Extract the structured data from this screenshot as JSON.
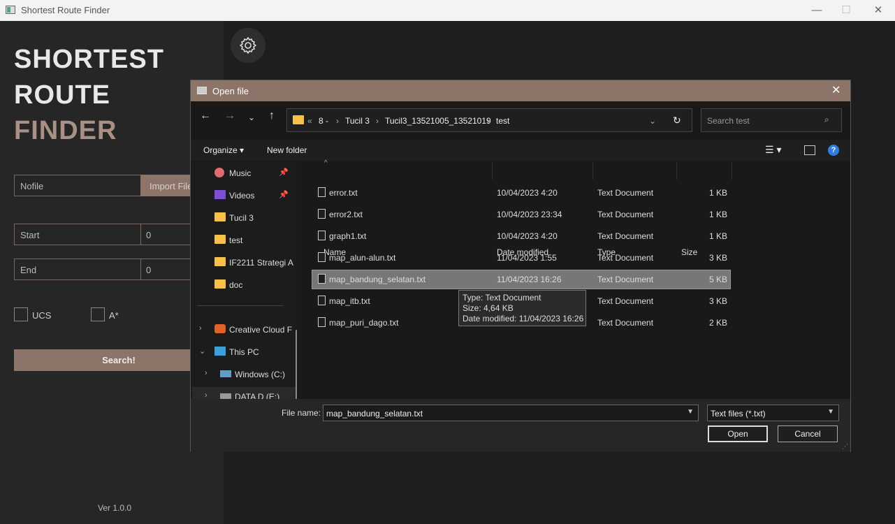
{
  "window": {
    "title": "Shortest Route Finder",
    "minimize": "—",
    "maximize": "☐",
    "close": "✕"
  },
  "brand": {
    "line1": "SHORTEST",
    "line2": "ROUTE",
    "line3": "FINDER"
  },
  "sidebar": {
    "file_label": "Nofile",
    "import_label": "Import File",
    "start_label": "Start",
    "start_value": "0",
    "end_label": "End",
    "end_value": "0",
    "ucs_label": "UCS",
    "astar_label": "A*",
    "search_label": "Search!",
    "version": "Ver 1.0.0"
  },
  "dialog": {
    "title": "Open file",
    "breadcrumbs": [
      "8 -",
      "Tucil 3",
      "Tucil3_13521005_13521019",
      "test"
    ],
    "search_placeholder": "Search test",
    "organize_label": "Organize ▾",
    "new_folder_label": "New folder",
    "nav_items": [
      {
        "label": "Music",
        "pinned": true
      },
      {
        "label": "Videos",
        "pinned": true
      },
      {
        "label": "Tucil 3"
      },
      {
        "label": "test"
      },
      {
        "label": "IF2211 Strategi A"
      },
      {
        "label": "doc"
      },
      {
        "label": "Creative Cloud F"
      },
      {
        "label": "This PC"
      },
      {
        "label": "Windows (C:)"
      },
      {
        "label": "DATA D (E:)"
      }
    ],
    "columns": {
      "name": "Name",
      "date": "Date modified",
      "type": "Type",
      "size": "Size"
    },
    "files": [
      {
        "name": "error.txt",
        "date": "10/04/2023 4:20",
        "type": "Text Document",
        "size": "1 KB"
      },
      {
        "name": "error2.txt",
        "date": "10/04/2023 23:34",
        "type": "Text Document",
        "size": "1 KB"
      },
      {
        "name": "graph1.txt",
        "date": "10/04/2023 4:20",
        "type": "Text Document",
        "size": "1 KB"
      },
      {
        "name": "map_alun-alun.txt",
        "date": "11/04/2023 1:55",
        "type": "Text Document",
        "size": "3 KB"
      },
      {
        "name": "map_bandung_selatan.txt",
        "date": "11/04/2023 16:26",
        "type": "Text Document",
        "size": "5 KB"
      },
      {
        "name": "map_itb.txt",
        "date": "",
        "type": "Text Document",
        "size": "3 KB"
      },
      {
        "name": "map_puri_dago.txt",
        "date": "",
        "type": "Text Document",
        "size": "2 KB"
      }
    ],
    "tooltip": {
      "line1": "Type: Text Document",
      "line2": "Size: 4,64 KB",
      "line3": "Date modified: 11/04/2023 16:26"
    },
    "file_name_label": "File name:",
    "file_name_value": "map_bandung_selatan.txt",
    "file_type_value": "Text files (*.txt)",
    "open_label": "Open",
    "cancel_label": "Cancel"
  },
  "colors": {
    "accent": "#8c7568",
    "brand_white": "#e8e8e8",
    "brand_accent": "#a89084"
  }
}
